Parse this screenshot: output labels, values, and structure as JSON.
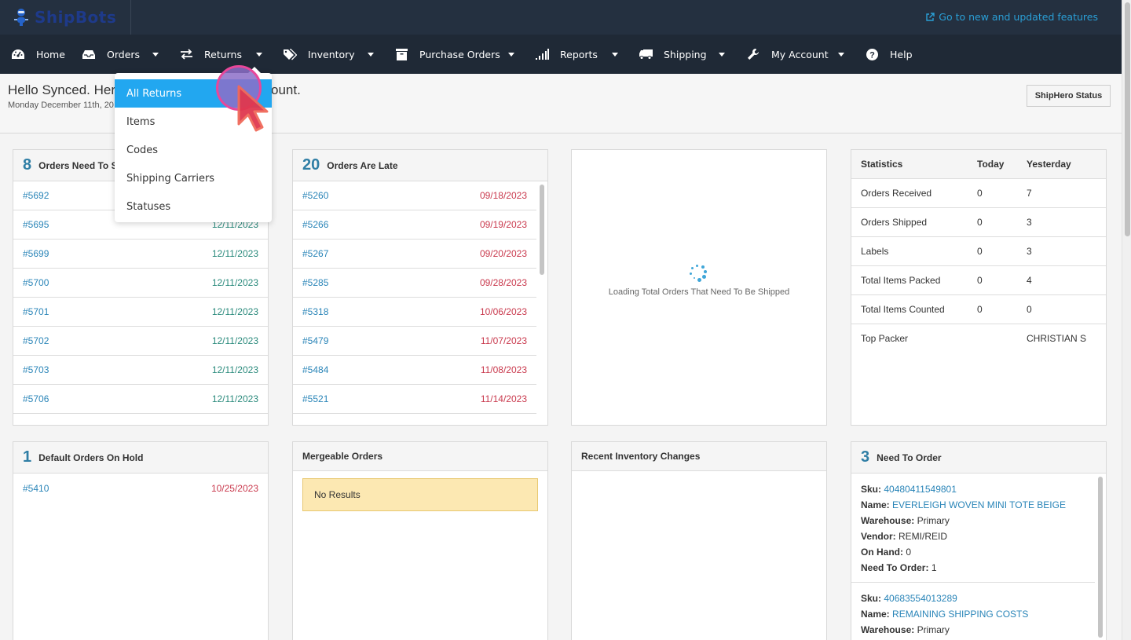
{
  "brand": {
    "logo_text": "ShipBots"
  },
  "topbar": {
    "updates_link": "Go to new and updated features",
    "updates_icon": "external-link-icon"
  },
  "nav": {
    "items": [
      {
        "label": "Home",
        "icon": "dashboard-icon",
        "has_caret": false
      },
      {
        "label": "Orders",
        "icon": "inbox-icon",
        "has_caret": true
      },
      {
        "label": "Returns",
        "icon": "exchange-icon",
        "has_caret": true
      },
      {
        "label": "Inventory",
        "icon": "tags-icon",
        "has_caret": true
      },
      {
        "label": "Purchase Orders",
        "icon": "archive-icon",
        "has_caret": true
      },
      {
        "label": "Reports",
        "icon": "signal-icon",
        "has_caret": true
      },
      {
        "label": "Shipping",
        "icon": "truck-icon",
        "has_caret": true
      },
      {
        "label": "My Account",
        "icon": "wrench-icon",
        "has_caret": true
      },
      {
        "label": "Help",
        "icon": "question-circle-icon",
        "has_caret": false
      }
    ]
  },
  "returns_menu": {
    "items": [
      {
        "label": "All Returns",
        "active": true
      },
      {
        "label": "Items",
        "active": false
      },
      {
        "label": "Codes",
        "active": false
      },
      {
        "label": "Shipping Carriers",
        "active": false
      },
      {
        "label": "Statuses",
        "active": false
      }
    ]
  },
  "header": {
    "greeting_visible_start": "Hello Synced. Here",
    "greeting_visible_end": "ount.",
    "date_visible": "Monday December 11th, 20",
    "status_button": "ShipHero Status"
  },
  "panels": {
    "need_to_ship": {
      "count": "8",
      "title_visible": "Orders Need To S",
      "rows": [
        {
          "order": "#5692",
          "date": ""
        },
        {
          "order": "#5695",
          "date": "12/11/2023"
        },
        {
          "order": "#5699",
          "date": "12/11/2023"
        },
        {
          "order": "#5700",
          "date": "12/11/2023"
        },
        {
          "order": "#5701",
          "date": "12/11/2023"
        },
        {
          "order": "#5702",
          "date": "12/11/2023"
        },
        {
          "order": "#5703",
          "date": "12/11/2023"
        },
        {
          "order": "#5706",
          "date": "12/11/2023"
        }
      ]
    },
    "late": {
      "count": "20",
      "title": "Orders Are Late",
      "rows": [
        {
          "order": "#5260",
          "date": "09/18/2023"
        },
        {
          "order": "#5266",
          "date": "09/19/2023"
        },
        {
          "order": "#5267",
          "date": "09/20/2023"
        },
        {
          "order": "#5285",
          "date": "09/28/2023"
        },
        {
          "order": "#5318",
          "date": "10/06/2023"
        },
        {
          "order": "#5479",
          "date": "11/07/2023"
        },
        {
          "order": "#5484",
          "date": "11/08/2023"
        },
        {
          "order": "#5521",
          "date": "11/14/2023"
        }
      ]
    },
    "loading": {
      "text": "Loading Total Orders That Need To Be Shipped"
    },
    "statistics": {
      "headers": [
        "Statistics",
        "Today",
        "Yesterday"
      ],
      "rows": [
        {
          "label": "Orders Received",
          "today": "0",
          "yesterday": "7"
        },
        {
          "label": "Orders Shipped",
          "today": "0",
          "yesterday": "3"
        },
        {
          "label": "Labels",
          "today": "0",
          "yesterday": "3"
        },
        {
          "label": "Total Items Packed",
          "today": "0",
          "yesterday": "4"
        },
        {
          "label": "Total Items Counted",
          "today": "0",
          "yesterday": "0"
        },
        {
          "label": "Top Packer",
          "today": "",
          "yesterday": "CHRISTIAN S"
        }
      ]
    },
    "on_hold": {
      "count": "1",
      "title": "Default Orders On Hold",
      "rows": [
        {
          "order": "#5410",
          "date": "10/25/2023"
        }
      ]
    },
    "mergeable": {
      "title": "Mergeable Orders",
      "empty_text": "No Results"
    },
    "inventory_changes": {
      "title": "Recent Inventory Changes"
    },
    "need_to_order": {
      "count": "3",
      "title": "Need To Order",
      "labels": {
        "sku": "Sku:",
        "name": "Name:",
        "warehouse": "Warehouse:",
        "vendor": "Vendor:",
        "on_hand": "On Hand:",
        "need": "Need To Order:"
      },
      "items": [
        {
          "sku": "40480411549801",
          "name": "EVERLEIGH WOVEN MINI TOTE BEIGE",
          "warehouse": "Primary",
          "vendor": "REMI/REID",
          "on_hand": "0",
          "need": "1"
        },
        {
          "sku": "40683554013289",
          "name": "REMAINING SHIPPING COSTS",
          "warehouse": "Primary"
        }
      ]
    }
  },
  "colors": {
    "topbar": "#243040",
    "navbar": "#1f2936",
    "link": "#2a85b8",
    "accent": "#22a7f0",
    "late_date": "#c9394d",
    "today_date": "#2a8a7c",
    "count": "#2f7ea5"
  }
}
